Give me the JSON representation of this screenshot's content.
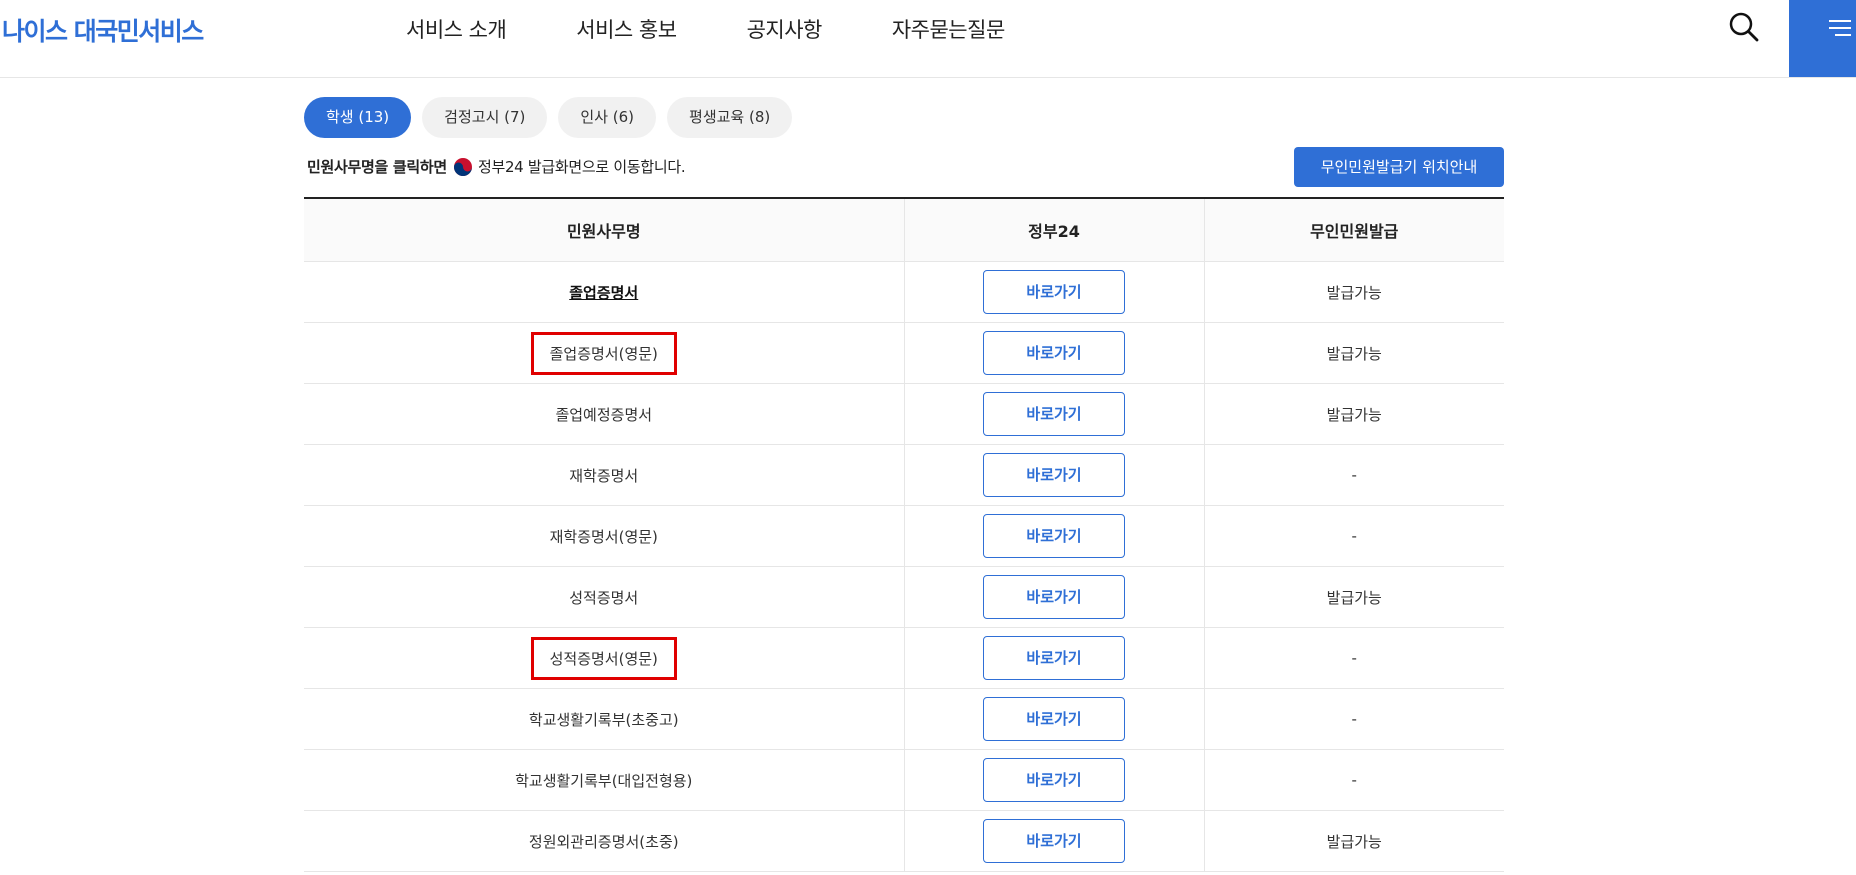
{
  "header": {
    "logo": "나이스 대국민서비스",
    "nav": [
      "서비스 소개",
      "서비스 홍보",
      "공지사항",
      "자주묻는질문"
    ]
  },
  "tabs": [
    {
      "label": "학생 (13)",
      "active": true
    },
    {
      "label": "검정고시 (7)",
      "active": false
    },
    {
      "label": "인사 (6)",
      "active": false
    },
    {
      "label": "평생교육 (8)",
      "active": false
    }
  ],
  "notice": {
    "prefix": "민원사무명을 클릭하면",
    "suffix": "정부24 발급화면으로 이동합니다."
  },
  "kiosk_button": "무인민원발급기 위치안내",
  "table": {
    "headers": [
      "민원사무명",
      "정부24",
      "무인민원발급"
    ],
    "button_label": "바로가기",
    "rows": [
      {
        "name": "졸업증명서",
        "kiosk": "발급가능"
      },
      {
        "name": "졸업증명서(영문)",
        "kiosk": "발급가능"
      },
      {
        "name": "졸업예정증명서",
        "kiosk": "발급가능"
      },
      {
        "name": "재학증명서",
        "kiosk": "-"
      },
      {
        "name": "재학증명서(영문)",
        "kiosk": "-"
      },
      {
        "name": "성적증명서",
        "kiosk": "발급가능"
      },
      {
        "name": "성적증명서(영문)",
        "kiosk": "-"
      },
      {
        "name": "학교생활기록부(초중고)",
        "kiosk": "-"
      },
      {
        "name": "학교생활기록부(대입전형용)",
        "kiosk": "-"
      },
      {
        "name": "정원외관리증명서(초중)",
        "kiosk": "발급가능"
      }
    ]
  },
  "colors": {
    "accent": "#2f6fd6",
    "highlight_box": "#e00000"
  },
  "icons": [
    "search-icon",
    "menu-icon",
    "gov-emblem-icon"
  ]
}
